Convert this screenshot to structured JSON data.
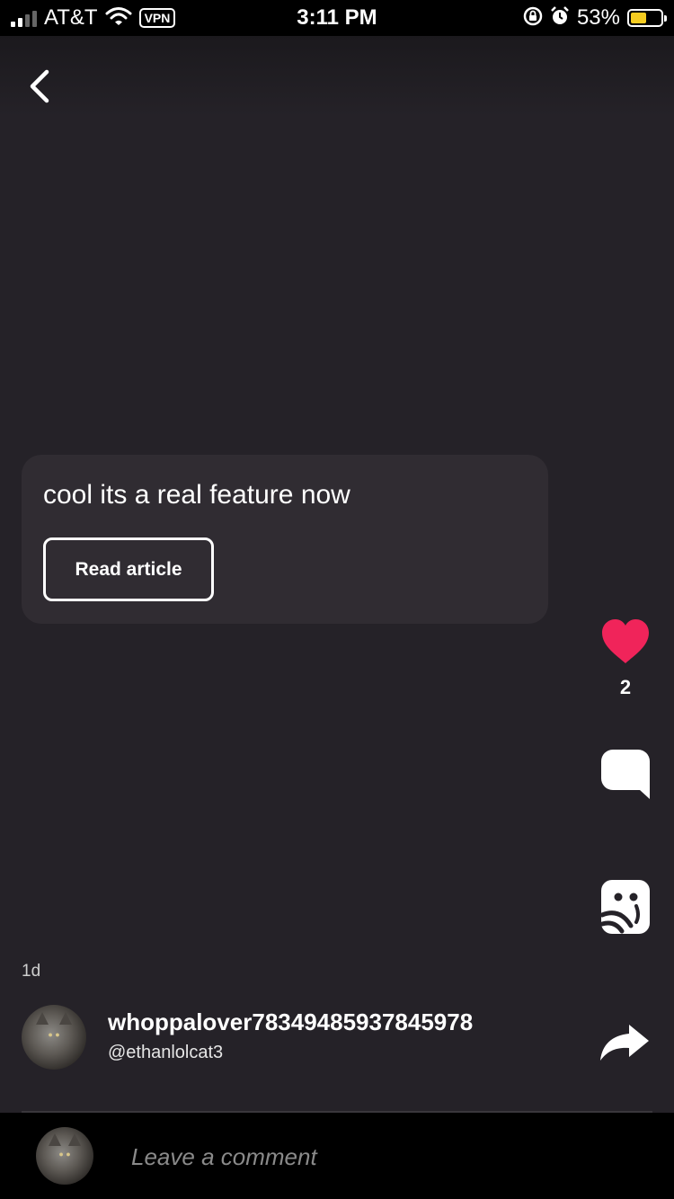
{
  "status_bar": {
    "carrier": "AT&T",
    "vpn": "VPN",
    "time": "3:11 PM",
    "battery": "53%",
    "battery_level": 0.53,
    "battery_color": "#f5cc20",
    "icons": [
      "signal-icon",
      "wifi-icon",
      "rotation-lock-icon",
      "alarm-icon",
      "battery-icon"
    ]
  },
  "nav": {
    "back_icon": "chevron-left-icon"
  },
  "post": {
    "text": "cool its a real feature now",
    "button_label": "Read article"
  },
  "actions": {
    "like_count": "2",
    "like_color": "#f0245a",
    "icons": [
      "heart-icon",
      "comment-icon",
      "sticker-icon",
      "share-icon"
    ]
  },
  "meta": {
    "time_ago": "1d",
    "author_name": "whoppalover78349485937845978",
    "author_handle": "@ethanlolcat3"
  },
  "comment_bar": {
    "placeholder": "Leave a comment"
  }
}
